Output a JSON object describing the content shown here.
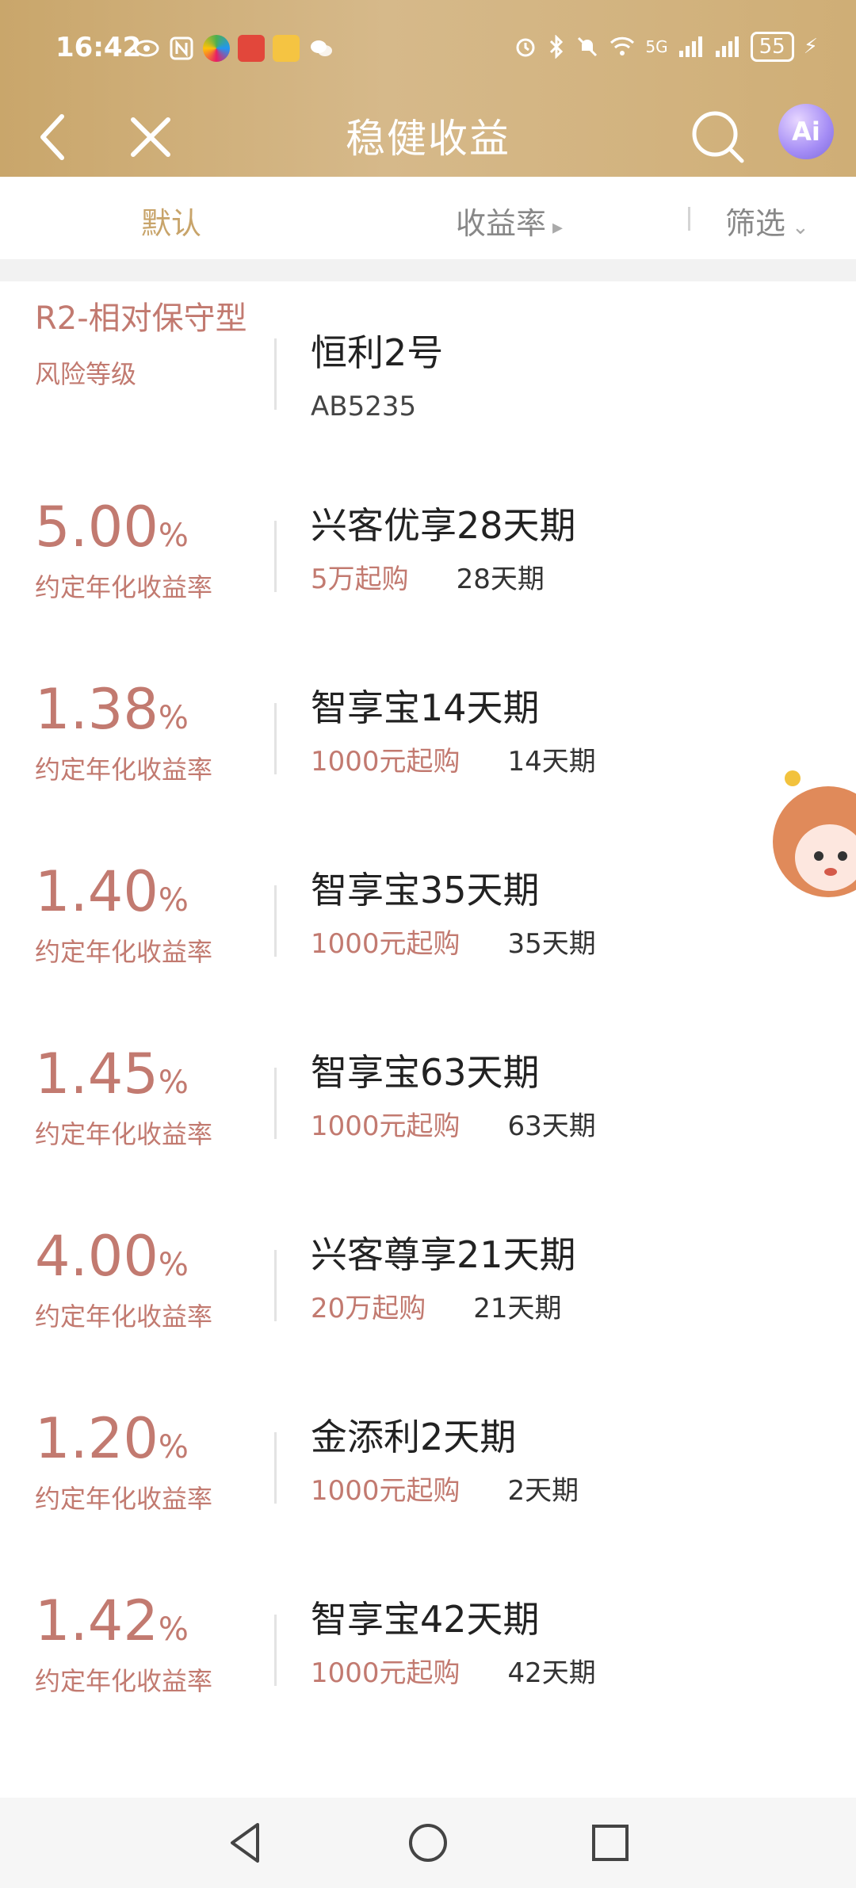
{
  "status_bar": {
    "time": "16:42",
    "right_signal": "5G",
    "battery": "55"
  },
  "header": {
    "title": "稳健收益",
    "ai_label": "Ai"
  },
  "tabs": {
    "default": "默认",
    "rate": "收益率",
    "filter": "筛选"
  },
  "risk": {
    "level": "R2-相对保守型",
    "label": "风险等级",
    "product": "恒利2号",
    "code": "AB5235"
  },
  "products": [
    {
      "rate": "5.00",
      "unit": "%",
      "rate_label": "约定年化收益率",
      "name": "兴客优享28天期",
      "min": "5万起购",
      "term": "28天期"
    },
    {
      "rate": "1.38",
      "unit": "%",
      "rate_label": "约定年化收益率",
      "name": "智享宝14天期",
      "min": "1000元起购",
      "term": "14天期"
    },
    {
      "rate": "1.40",
      "unit": "%",
      "rate_label": "约定年化收益率",
      "name": "智享宝35天期",
      "min": "1000元起购",
      "term": "35天期"
    },
    {
      "rate": "1.45",
      "unit": "%",
      "rate_label": "约定年化收益率",
      "name": "智享宝63天期",
      "min": "1000元起购",
      "term": "63天期"
    },
    {
      "rate": "4.00",
      "unit": "%",
      "rate_label": "约定年化收益率",
      "name": "兴客尊享21天期",
      "min": "20万起购",
      "term": "21天期"
    },
    {
      "rate": "1.20",
      "unit": "%",
      "rate_label": "约定年化收益率",
      "name": "金添利2天期",
      "min": "1000元起购",
      "term": "2天期"
    },
    {
      "rate": "1.42",
      "unit": "%",
      "rate_label": "约定年化收益率",
      "name": "智享宝42天期",
      "min": "1000元起购",
      "term": "42天期"
    }
  ],
  "colors": {
    "header_gold": "#c9a66b",
    "accent_red": "#c27a70",
    "tab_active": "#c8a46a"
  }
}
